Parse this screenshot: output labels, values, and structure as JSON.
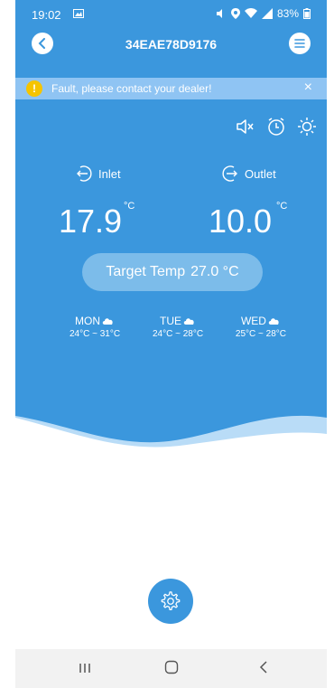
{
  "status_bar": {
    "time": "19:02",
    "battery": "83%"
  },
  "header": {
    "title": "34EAE78D9176"
  },
  "fault_banner": {
    "message": "Fault, please contact your dealer!",
    "close": "×"
  },
  "readings": {
    "inlet_label": "Inlet",
    "outlet_label": "Outlet",
    "inlet_temp": "17.9",
    "outlet_temp": "10.0",
    "unit": "°C"
  },
  "target": {
    "label": "Target Temp",
    "value": "27.0 °C"
  },
  "forecast": [
    {
      "day": "MON",
      "range": "24°C ~ 31°C"
    },
    {
      "day": "TUE",
      "range": "24°C ~ 28°C"
    },
    {
      "day": "WED",
      "range": "25°C ~ 28°C"
    }
  ],
  "colors": {
    "primary": "#3b97dd",
    "banner": "#8fc4f3",
    "warning": "#f5c400"
  },
  "icons": {
    "mute": "mute-icon",
    "alarm": "alarm-clock-icon",
    "sun": "sun-icon",
    "settings": "gear-icon",
    "back": "chevron-left-icon",
    "menu": "menu-icon"
  }
}
